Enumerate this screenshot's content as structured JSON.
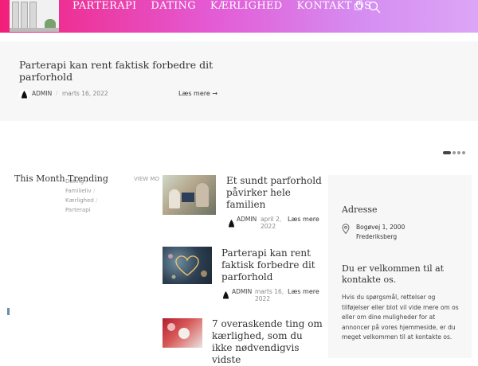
{
  "header": {
    "nav": [
      "PARTERAPI",
      "DATING",
      "KÆRLIGHED",
      "KONTAKT OS"
    ],
    "cart_count": "0"
  },
  "hero": {
    "title": "Parterapi kan rent faktisk forbedre dit parforhold",
    "author": "ADMIN",
    "date": "marts 16, 2022",
    "read_more": "Læs mere →"
  },
  "trending": {
    "title": "This Month Trending",
    "view_more": "VIEW MO",
    "categories": [
      "Dating",
      "Familieliv",
      "Kærlighed",
      "Parterapi"
    ]
  },
  "posts": [
    {
      "title": "Et sundt parforhold påvirker hele familien",
      "author": "ADMIN",
      "date": "april 2, 2022",
      "read_more": "Læs mere"
    },
    {
      "title": "Parterapi kan rent faktisk forbedre dit parforhold",
      "author": "ADMIN",
      "date": "marts 16, 2022",
      "read_more": "Læs mere"
    },
    {
      "title": "7 overaskende ting om kærlighed, som du ikke nødvendigvis vidste",
      "author": "",
      "date": "",
      "read_more": ""
    }
  ],
  "sidebar": {
    "address_heading": "Adresse",
    "address_line1": "Bogøvej 1, 2000",
    "address_line2": "Frederiksberg",
    "welcome_heading": "Du er velkommen til at kontakte os.",
    "welcome_text": "Hvis du spørgsmål, rettelser og tilføjelser eller blot vil vide mere om os eller om dine muligheder for at annoncer på vores hjemmeside, er du meget velkommen til at kontakte os."
  },
  "colors": {
    "header_gradient_start": "#f21f7a",
    "header_gradient_end": "#dca6f6",
    "panel_background": "#f7f7f7"
  },
  "icons": [
    "logo-image",
    "cart-icon",
    "search-icon",
    "author-avatar-icon",
    "map-pin-icon"
  ]
}
